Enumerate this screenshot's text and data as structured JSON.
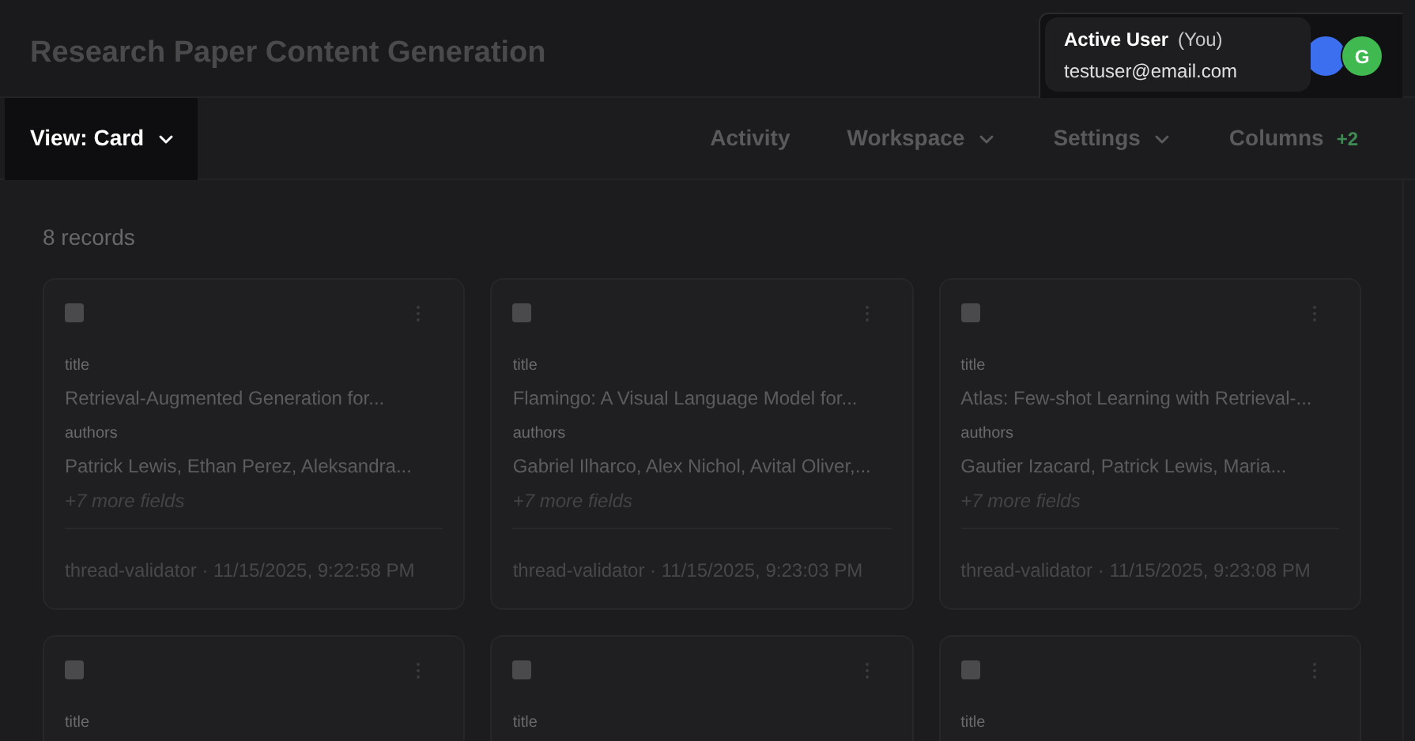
{
  "header": {
    "title": "Research Paper Content Generation",
    "avatars": [
      {
        "color": "#3b6ff0"
      },
      {
        "initial": "G",
        "color": "#3fb950"
      }
    ],
    "tooltip": {
      "name": "Active User",
      "suffix": "(You)",
      "email": "testuser@email.com"
    }
  },
  "toolbar": {
    "view_button": "View: Card",
    "nav": [
      {
        "label": "Activity",
        "dropdown": false
      },
      {
        "label": "Workspace",
        "dropdown": true
      },
      {
        "label": "Settings",
        "dropdown": true
      },
      {
        "label": "Columns",
        "dropdown": false,
        "badge": "+2"
      }
    ]
  },
  "record_count": "8 records",
  "cards": [
    {
      "checked": false,
      "fields": [
        {
          "label": "title",
          "value": "Retrieval-Augmented Generation for..."
        },
        {
          "label": "authors",
          "value": "Patrick Lewis, Ethan Perez, Aleksandra..."
        }
      ],
      "more": "+7 more fields",
      "footer": "thread-validator · 11/15/2025, 9:22:58 PM"
    },
    {
      "checked": false,
      "fields": [
        {
          "label": "title",
          "value": "Flamingo: A Visual Language Model for..."
        },
        {
          "label": "authors",
          "value": "Gabriel Ilharco, Alex Nichol, Avital Oliver,..."
        }
      ],
      "more": "+7 more fields",
      "footer": "thread-validator · 11/15/2025, 9:23:03 PM"
    },
    {
      "checked": false,
      "fields": [
        {
          "label": "title",
          "value": "Atlas: Few-shot Learning with Retrieval-..."
        },
        {
          "label": "authors",
          "value": "Gautier Izacard, Patrick Lewis, Maria..."
        }
      ],
      "more": "+7 more fields",
      "footer": "thread-validator · 11/15/2025, 9:23:08 PM"
    },
    {
      "checked": false,
      "fields": [
        {
          "label": "title"
        }
      ]
    },
    {
      "checked": false,
      "fields": [
        {
          "label": "title"
        }
      ]
    },
    {
      "checked": false,
      "fields": [
        {
          "label": "title"
        }
      ]
    }
  ]
}
